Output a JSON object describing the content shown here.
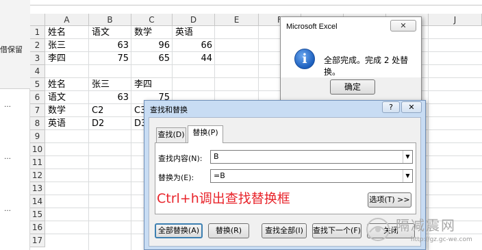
{
  "left_pane": {
    "keep_label": "借保留",
    "ellipses": [
      "…",
      "…",
      "…"
    ]
  },
  "sheet": {
    "columns": [
      "A",
      "B",
      "C",
      "D",
      "E",
      "F",
      "G",
      "H",
      "I",
      "J"
    ],
    "rows": [
      "1",
      "2",
      "3",
      "4",
      "5",
      "6",
      "7",
      "8",
      "9",
      "10",
      "11",
      "12",
      "13",
      "14",
      "15",
      "16",
      "17"
    ],
    "cells": {
      "A1": "姓名",
      "B1": "语文",
      "C1": "数学",
      "D1": "英语",
      "A2": "张三",
      "B2": "63",
      "C2": "96",
      "D2": "66",
      "A3": "李四",
      "B3": "75",
      "C3": "65",
      "D3": "44",
      "A5": "姓名",
      "B5": "张三",
      "C5": "李四",
      "A6": "语文",
      "B6": "63",
      "C6": "75",
      "A7": "数学",
      "B7": "C2",
      "C7": "C3",
      "A8": "英语",
      "B8": "D2",
      "C8": "D3"
    }
  },
  "msgbox": {
    "title": "Microsoft Excel",
    "close": "✕",
    "icon": "info-icon",
    "icon_glyph": "i",
    "message": "全部完成。完成 2 处替换。",
    "ok_label": "确定"
  },
  "dialog": {
    "title": "查找和替换",
    "help": "?",
    "close": "✕",
    "tabs": [
      "查找(D)",
      "替换(P)"
    ],
    "find_label": "查找内容(N):",
    "find_value": "B",
    "replace_label": "替换为(E):",
    "replace_value": "=B",
    "options_label": "选项(T) >>",
    "annotation": "Ctrl+h调出查找替换框",
    "buttons": {
      "replace_all": "全部替换(A)",
      "replace": "替换(R)",
      "find_all": "查找全部(I)",
      "find_next": "查找下一个(F)",
      "close": "关闭"
    },
    "dropdown_glyph": "▼"
  },
  "watermark": {
    "big": "隔减震网",
    "small": "http://gz.gc-we.com"
  }
}
